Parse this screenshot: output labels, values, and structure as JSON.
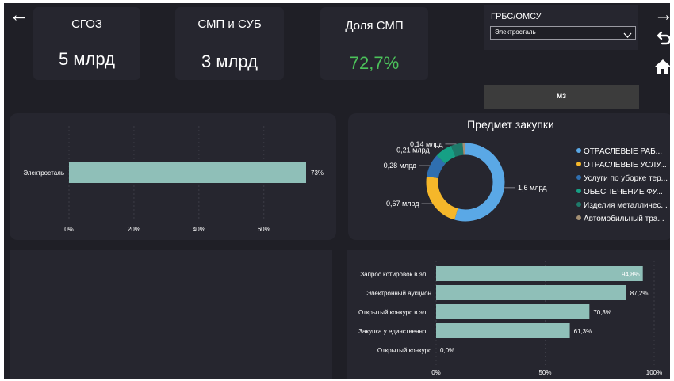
{
  "kpis": [
    {
      "title": "СГОЗ",
      "value": "5 млрд"
    },
    {
      "title": "СМП и СУБ",
      "value": "3 млрд"
    },
    {
      "title": "Доля СМП",
      "value": "72,7%",
      "value_color": "#4cc35b"
    }
  ],
  "filter": {
    "label": "ГРБС/ОМСУ",
    "selected": "Электросталь"
  },
  "mz_button": "мз",
  "nav": {
    "back": "←",
    "forward": "→",
    "undo": "↶",
    "home": "⌂"
  },
  "colors": {
    "background": "#1f1f26",
    "card": "#26262f",
    "bar": "#8fbfb8",
    "kpi_accent": "#4cc35b"
  },
  "chart_data": [
    {
      "type": "bar",
      "orientation": "horizontal",
      "categories": [
        "Электросталь"
      ],
      "values": [
        73
      ],
      "data_labels": [
        "73%"
      ],
      "xlim": [
        0,
        73
      ],
      "xticks": [
        "0%",
        "20%",
        "40%",
        "60%"
      ],
      "grid": true
    },
    {
      "type": "pie",
      "donut": true,
      "title": "Предмет закупки",
      "legend_position": "right",
      "slices": [
        {
          "label": "ОТРАСЛЕВЫЕ РАБ...",
          "value": 1.6,
          "data_label": "1,6 млрд",
          "color": "#5aa8e6"
        },
        {
          "label": "ОТРАСЛЕВЫЕ УСЛУ...",
          "value": 0.67,
          "data_label": "0,67 млрд",
          "color": "#f5b72a"
        },
        {
          "label": "Услуги по уборке тер...",
          "value": 0.28,
          "data_label": "0,28 млрд",
          "color": "#2f6fb0"
        },
        {
          "label": "ОБЕСПЕЧЕНИЕ ФУ...",
          "value": 0.21,
          "data_label": "0,21 млрд",
          "color": "#16a085"
        },
        {
          "label": "Изделия металличес...",
          "value": 0.14,
          "data_label": "0,14 млрд",
          "color": "#1e7a6a"
        },
        {
          "label": "Автомобильный тра...",
          "value": 0.04,
          "data_label": "",
          "color": "#a38f73"
        }
      ]
    },
    {
      "type": "bar",
      "orientation": "horizontal",
      "categories": [
        "Запрос котировок в эл...",
        "Электронный аукцион",
        "Открытый конкурс в эл...",
        "Закупка у единственно...",
        "Открытый конкурс"
      ],
      "values": [
        94.8,
        87.2,
        70.3,
        61.3,
        0
      ],
      "data_labels": [
        "94,8%",
        "87,2%",
        "70,3%",
        "61,3%",
        "0,0%"
      ],
      "xlim": [
        0,
        100
      ],
      "xticks": [
        "0%",
        "50%",
        "100%"
      ],
      "grid": true
    }
  ]
}
